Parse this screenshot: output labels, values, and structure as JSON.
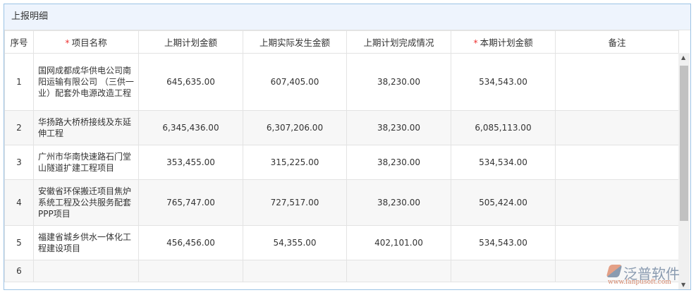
{
  "title": "上报明细",
  "columns": {
    "seq": "序号",
    "name": "项目名称",
    "last_plan": "上期计划金额",
    "last_actual": "上期实际发生金额",
    "last_completion": "上期计划完成情况",
    "this_plan": "本期计划金额",
    "remark": "备注",
    "required_mark": "*"
  },
  "rows": [
    {
      "seq": "1",
      "name": "国网成都成华供电公司南阳运输有限公司 （三供一业）配套外电源改造工程",
      "last_plan": "645,635.00",
      "last_actual": "607,405.00",
      "last_completion": "38,230.00",
      "this_plan": "534,543.00",
      "remark": ""
    },
    {
      "seq": "2",
      "name": "华扬路大桥桥接线及东延伸工程",
      "last_plan": "6,345,436.00",
      "last_actual": "6,307,206.00",
      "last_completion": "38,230.00",
      "this_plan": "6,085,113.00",
      "remark": ""
    },
    {
      "seq": "3",
      "name": "广州市华南快速路石门堂山隧道扩建工程项目",
      "last_plan": "353,455.00",
      "last_actual": "315,225.00",
      "last_completion": "38,230.00",
      "this_plan": "534,534.00",
      "remark": ""
    },
    {
      "seq": "4",
      "name": "安徽省环保搬迁项目焦炉系统工程及公共服务配套PPP项目",
      "last_plan": "765,747.00",
      "last_actual": "727,517.00",
      "last_completion": "38,230.00",
      "this_plan": "505,424.00",
      "remark": ""
    },
    {
      "seq": "5",
      "name": "福建省城乡供水一体化工程建设项目",
      "last_plan": "456,456.00",
      "last_actual": "54,355.00",
      "last_completion": "402,101.00",
      "this_plan": "534,543.00",
      "remark": ""
    },
    {
      "seq": "6",
      "name": "",
      "last_plan": "",
      "last_actual": "",
      "last_completion": "",
      "this_plan": "",
      "remark": ""
    }
  ],
  "watermark": {
    "brand": "泛普软件",
    "url": "www.fanpusoft.com"
  }
}
